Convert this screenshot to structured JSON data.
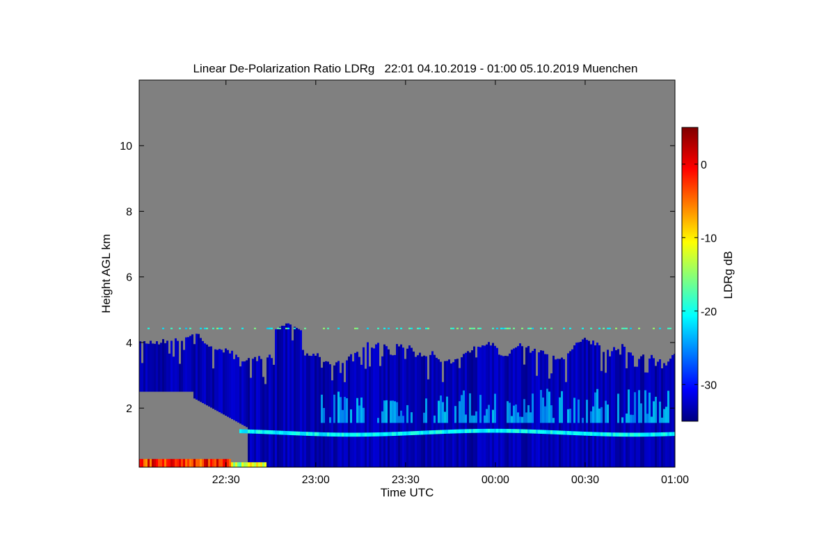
{
  "chart_data": {
    "type": "heatmap",
    "title": "Linear De-Polarization Ratio LDRg   22:01 04.10.2019 - 01:00 05.10.2019 Muenchen",
    "xlabel": "Time UTC",
    "ylabel": "Height AGL km",
    "x_tick_labels": [
      "22:30",
      "23:00",
      "23:30",
      "00:00",
      "00:30",
      "01:00"
    ],
    "x_tick_hours": [
      0.4833,
      0.9833,
      1.4833,
      1.9833,
      2.4833,
      2.9833
    ],
    "xlim_hours": [
      0,
      2.9833
    ],
    "ylim": [
      0.2,
      12.0
    ],
    "y_ticks": [
      2,
      4,
      6,
      8,
      10
    ],
    "y_tick_labels": [
      "2",
      "4",
      "6",
      "8",
      "10"
    ],
    "colorbar": {
      "label": "LDRg dB",
      "range": [
        -35,
        5
      ],
      "ticks": [
        0,
        -10,
        -20,
        -30
      ],
      "tick_labels": [
        "0",
        "-10",
        "-20",
        "-30"
      ],
      "colormap": "jet"
    },
    "no_signal_color": "#808080",
    "features": {
      "aerosol_top_km": 4.0,
      "plume_max_top_km": 4.6,
      "bright_layer_height_km": 1.25,
      "bright_layer_value_db": -20,
      "background_value_db": -33,
      "upper_patches_value_db": -24,
      "surface_value_db": -2
    },
    "grid": false,
    "legend": "colorbar-right"
  }
}
